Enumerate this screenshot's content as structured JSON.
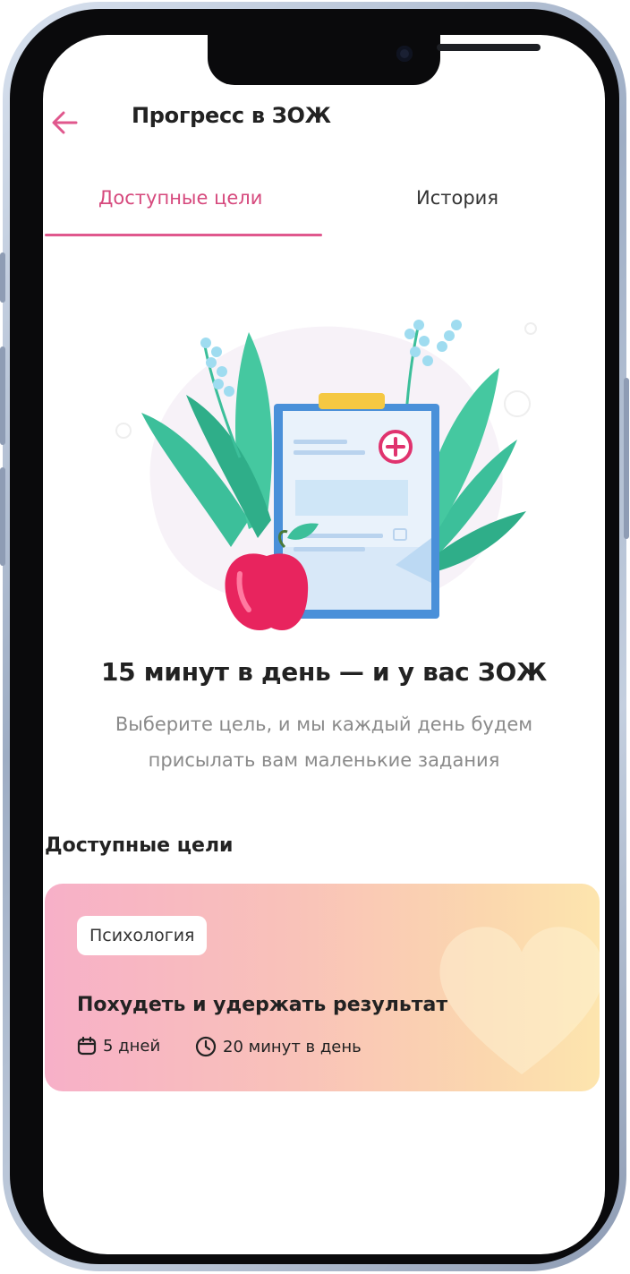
{
  "header": {
    "title": "Прогресс в ЗОЖ",
    "back_icon": "arrow-left-icon"
  },
  "tabs": [
    {
      "label": "Доступные цели",
      "active": true
    },
    {
      "label": "История",
      "active": false
    }
  ],
  "hero": {
    "illustration": "clipboard-plants-apple-illustration",
    "headline": "15 минут в день — и у вас ЗОЖ",
    "subtitle": "Выберите цель, и мы каждый день будем присылать вам маленькие задания"
  },
  "goals": {
    "section_title": "Доступные цели",
    "cards": [
      {
        "tag": "Психология",
        "title": "Похудеть и удержать результат",
        "duration": "5 дней",
        "duration_icon": "calendar-icon",
        "time": "20 минут в день",
        "time_icon": "clock-icon"
      }
    ]
  },
  "colors": {
    "accent": "#e0588d",
    "text": "#222222",
    "muted": "#8a8a8a"
  }
}
